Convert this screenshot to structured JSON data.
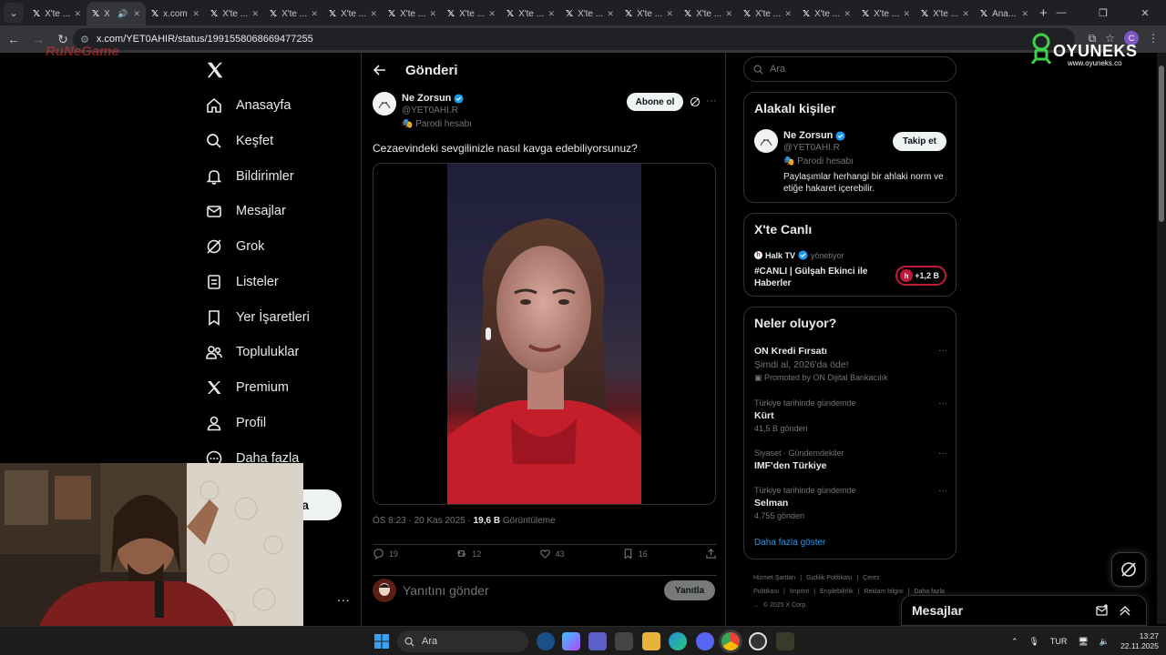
{
  "browser": {
    "tabs": [
      {
        "title": "X'te ..."
      },
      {
        "title": "X",
        "active": true,
        "audio": true
      },
      {
        "title": "x.com"
      },
      {
        "title": "X'te ..."
      },
      {
        "title": "X'te ..."
      },
      {
        "title": "X'te ..."
      },
      {
        "title": "X'te ..."
      },
      {
        "title": "X'te ..."
      },
      {
        "title": "X'te ..."
      },
      {
        "title": "X'te ..."
      },
      {
        "title": "X'te ..."
      },
      {
        "title": "X'te ..."
      },
      {
        "title": "X'te ..."
      },
      {
        "title": "X'te ..."
      },
      {
        "title": "X'te ..."
      },
      {
        "title": "X'te ..."
      },
      {
        "title": "Ana..."
      }
    ],
    "url": "x.com/YET0AHIR/status/1991558068669477255",
    "profile_initial": "C"
  },
  "overlay_brand": {
    "name": "OYUNEKS",
    "url": "www.oyuneks.co",
    "bg_logo": "RuNeGame"
  },
  "nav": {
    "items": [
      {
        "label": "Anasayfa",
        "icon": "home-icon"
      },
      {
        "label": "Keşfet",
        "icon": "search-icon"
      },
      {
        "label": "Bildirimler",
        "icon": "bell-icon"
      },
      {
        "label": "Mesajlar",
        "icon": "mail-icon"
      },
      {
        "label": "Grok",
        "icon": "grok-icon"
      },
      {
        "label": "Listeler",
        "icon": "list-icon"
      },
      {
        "label": "Yer İşaretleri",
        "icon": "bookmark-icon"
      },
      {
        "label": "Topluluklar",
        "icon": "people-icon"
      },
      {
        "label": "Premium",
        "icon": "x-logo-icon"
      },
      {
        "label": "Profil",
        "icon": "profile-icon"
      },
      {
        "label": "Daha fazla",
        "icon": "more-circle-icon"
      }
    ],
    "post_button": "a",
    "more": "..."
  },
  "main": {
    "header_title": "Gönderi",
    "author": {
      "name": "Ne Zorsun",
      "handle": "@YET0AHI.R",
      "badge": "Parodi hesabı"
    },
    "subscribe_label": "Abone ol",
    "text": "Cezaevindeki sevgilinizle nasıl kavga edebiliyorsunuz?",
    "meta": {
      "time": "ÖS 8:23 · 20 Kas 2025 · ",
      "views": "19,6 B",
      "views_label": " Görüntüleme"
    },
    "actions": {
      "replies": "19",
      "reposts": "12",
      "likes": "43",
      "bookmarks": "16"
    },
    "reply_placeholder": "Yanıtını gönder",
    "reply_button": "Yanıtla"
  },
  "right": {
    "search_placeholder": "Ara",
    "related": {
      "title": "Alakalı kişiler",
      "name": "Ne Zorsun",
      "handle": "@YET0AHI.R",
      "badge": "Parodi hesabı",
      "bio": "Paylaşımlar herhangi bir ahlaki norm ve etiğe hakaret içerebilir.",
      "follow_label": "Takip et"
    },
    "live": {
      "title": "X'te Canlı",
      "host": "Halk TV",
      "host_role": "yönetiyor",
      "stream_title": "#CANLI | Gülşah Ekinci ile Haberler",
      "listeners": "+1,2 B"
    },
    "trending": {
      "title": "Neler oluyor?",
      "items": [
        {
          "context": "",
          "title": "ON Kredi Fırsatı",
          "subtitle": "Şimdi al, 2026'da öde!",
          "count": "Promoted by ON Dijital Bankacılık"
        },
        {
          "context": "Türkiye tarihinde gündemde",
          "title": "Kürt",
          "subtitle": "",
          "count": "41,5 B gönderi"
        },
        {
          "context": "Siyaset · Gündemdekiler",
          "title": "IMF'den Türkiye",
          "subtitle": "",
          "count": ""
        },
        {
          "context": "Türkiye tarihinde gündemde",
          "title": "Selman",
          "subtitle": "",
          "count": "4.755 gönderi"
        }
      ],
      "show_more": "Daha fazla göster"
    },
    "footer": [
      "Hizmet Şartları",
      "|",
      "Gizlilik Politikası",
      "|",
      "Çerez Politikası",
      "|",
      "Imprint",
      "|",
      "Erişilebilirlik",
      "|",
      "Reklam bilgisi",
      "|",
      "Daha fazla ...",
      "© 2025 X Corp."
    ],
    "dm_drawer_title": "Mesajlar"
  },
  "taskbar": {
    "search_placeholder": "Ara",
    "lang": "TUR",
    "time": "13:27",
    "date": "22.11.2025"
  },
  "colors": {
    "accent": "#1d9bf0",
    "bg": "#000000",
    "border": "#2f3336",
    "muted": "#71767b",
    "live": "#c01a38"
  }
}
